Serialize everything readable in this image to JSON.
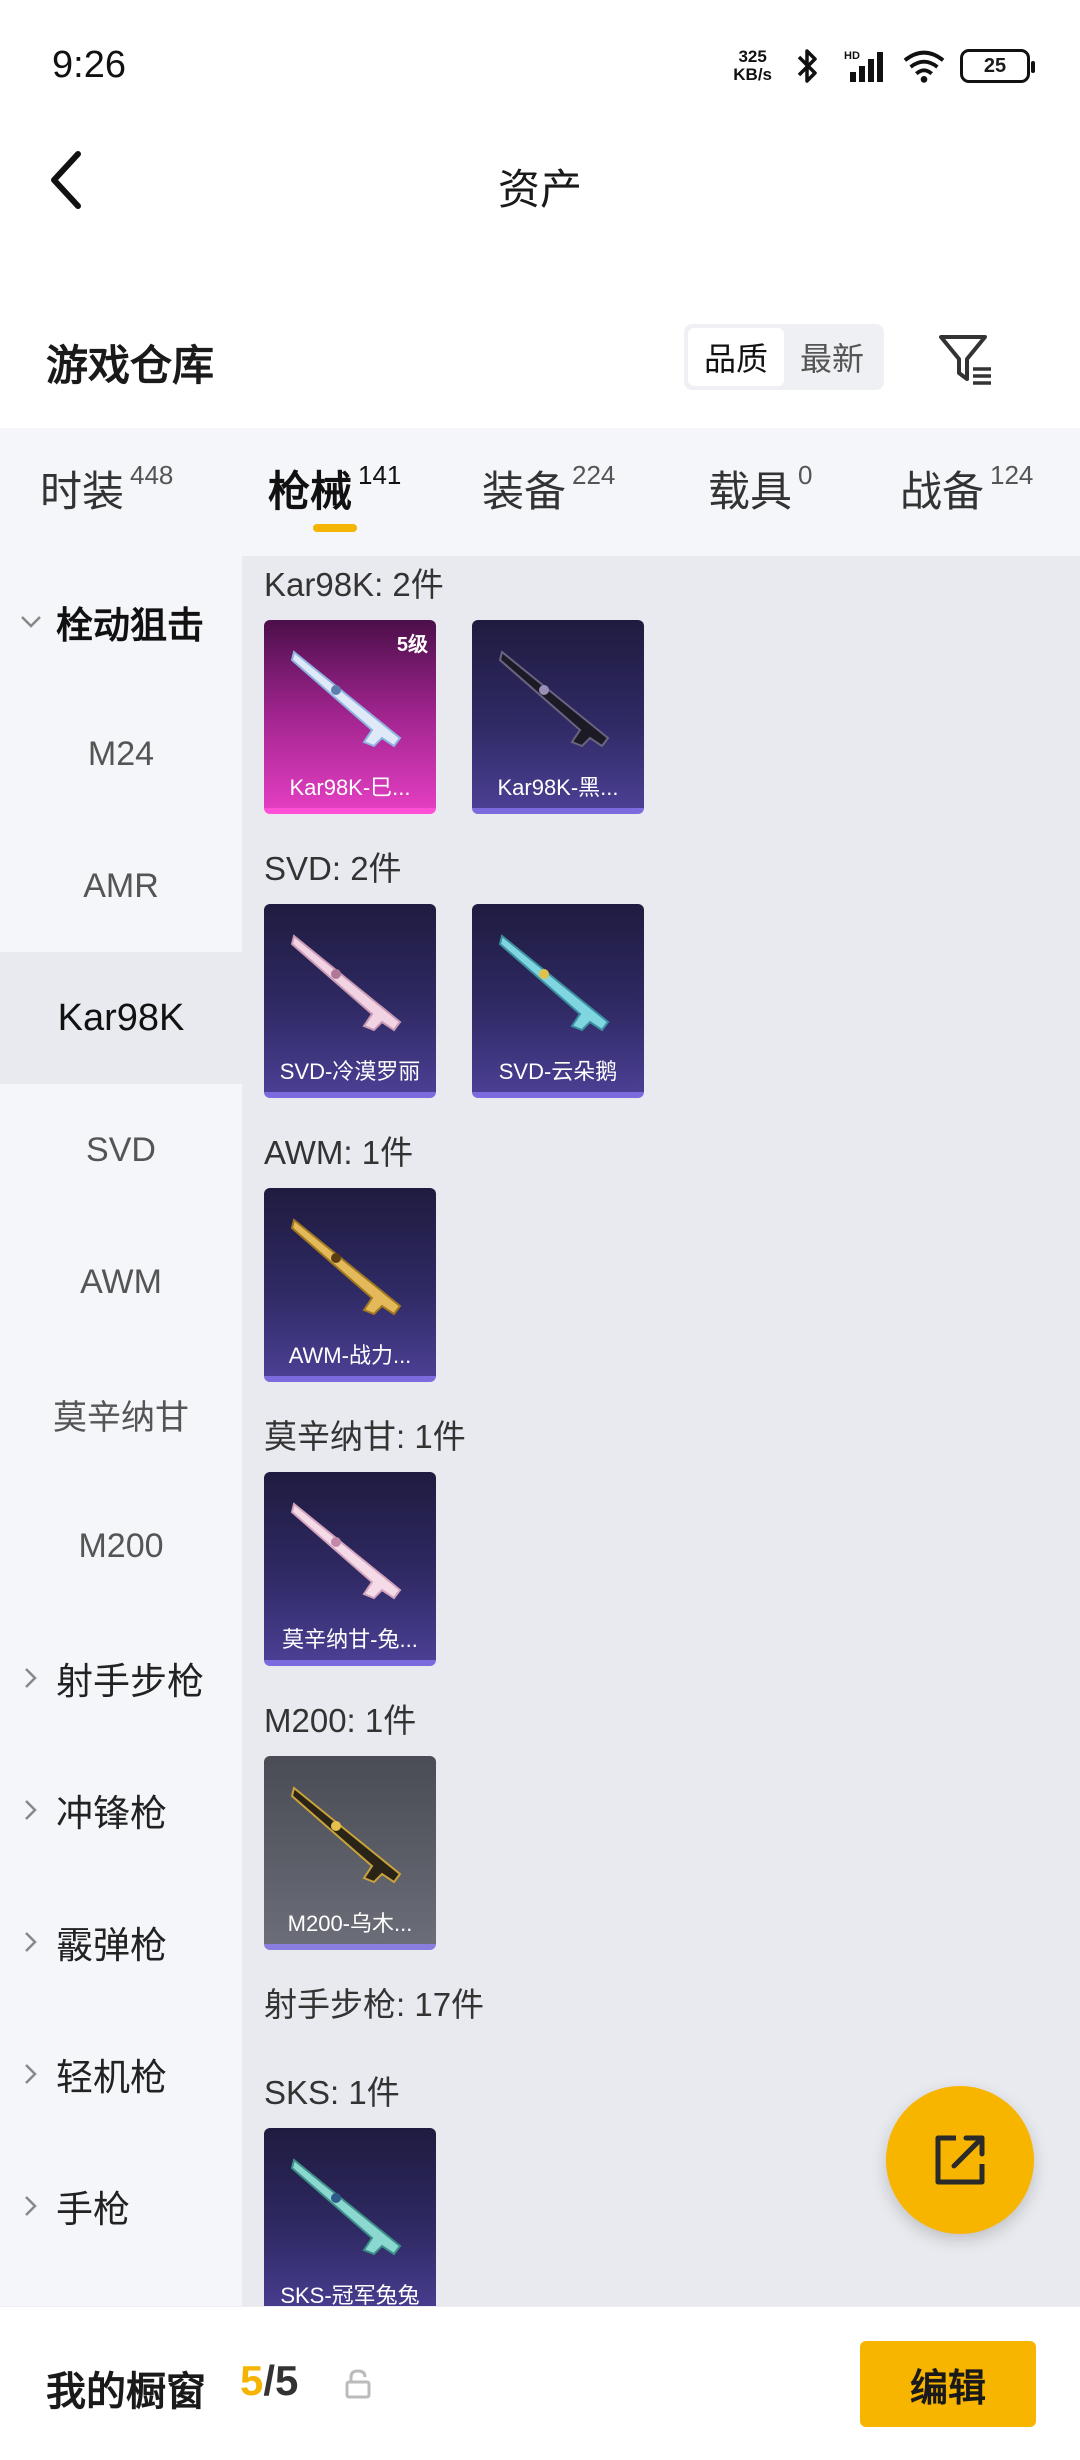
{
  "status_bar": {
    "time": "9:26",
    "speed_value": "325",
    "speed_unit": "KB/s",
    "battery": "25"
  },
  "header": {
    "title": "资产"
  },
  "warehouse": {
    "title": "游戏仓库",
    "sort_options": [
      "品质",
      "最新"
    ],
    "active_sort": "品质"
  },
  "tabs": [
    {
      "label": "时装",
      "count": "448"
    },
    {
      "label": "枪械",
      "count": "141"
    },
    {
      "label": "装备",
      "count": "224"
    },
    {
      "label": "载具",
      "count": "0"
    },
    {
      "label": "战备",
      "count": "124"
    }
  ],
  "active_tab": "枪械",
  "sidebar": {
    "items": [
      {
        "label": "栓动狙击"
      },
      {
        "label": "M24"
      },
      {
        "label": "AMR"
      },
      {
        "label": "Kar98K"
      },
      {
        "label": "SVD"
      },
      {
        "label": "AWM"
      },
      {
        "label": "莫辛纳甘"
      },
      {
        "label": "M200"
      },
      {
        "label": "射手步枪"
      },
      {
        "label": "冲锋枪"
      },
      {
        "label": "霰弹枪"
      },
      {
        "label": "轻机枪"
      },
      {
        "label": "手枪"
      }
    ],
    "selected": "Kar98K"
  },
  "content": {
    "sections": [
      {
        "heading": "Kar98K: 2件",
        "items": [
          {
            "label": "Kar98K-巳...",
            "level": "5级"
          },
          {
            "label": "Kar98K-黑..."
          }
        ]
      },
      {
        "heading": "SVD: 2件",
        "items": [
          {
            "label": "SVD-冷漠罗丽"
          },
          {
            "label": "SVD-云朵鹅"
          }
        ]
      },
      {
        "heading": "AWM: 1件",
        "items": [
          {
            "label": "AWM-战力..."
          }
        ]
      },
      {
        "heading": "莫辛纳甘: 1件",
        "items": [
          {
            "label": "莫辛纳甘-兔..."
          }
        ]
      },
      {
        "heading": "M200: 1件",
        "items": [
          {
            "label": "M200-乌木..."
          }
        ]
      },
      {
        "heading": "射手步枪: 17件"
      },
      {
        "heading": "SKS: 1件",
        "items": [
          {
            "label": "SKS-冠军兔兔"
          }
        ]
      }
    ]
  },
  "bottom_bar": {
    "title": "我的橱窗",
    "current": "5",
    "separator": "/",
    "total": "5",
    "edit_label": "编辑"
  },
  "colors": {
    "accent": "#f7b500",
    "card_purple": "#2f2a64",
    "card_pink": "#e23ec1",
    "card_gray": "#5b5d67"
  }
}
